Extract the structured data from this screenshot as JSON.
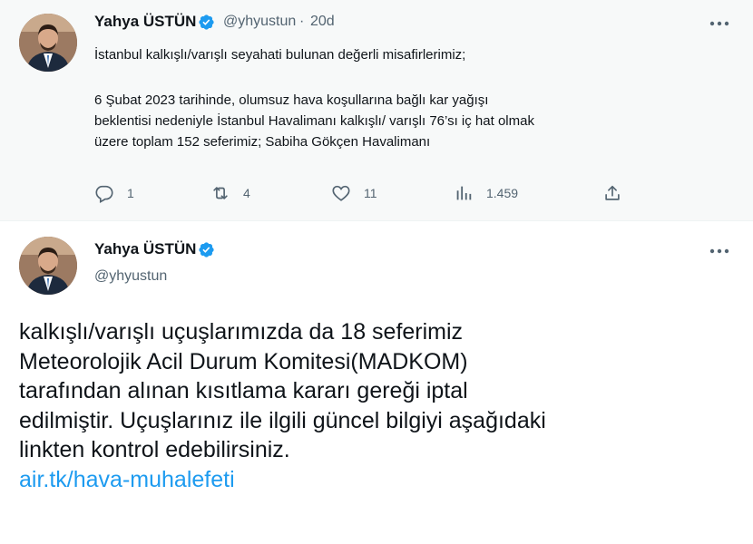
{
  "colors": {
    "accent": "#1d9bf0",
    "verified": "#1d9bf0",
    "muted": "#536471",
    "text": "#0f1419",
    "top_bg": "#f7f9f9"
  },
  "tweet1": {
    "author": "Yahya ÜSTÜN",
    "handle": "@yhyustun",
    "separator": "·",
    "time": "20d",
    "lines": [
      "İstanbul kalkışlı/varışlı seyahati bulunan değerli misafirlerimiz;",
      "6 Şubat 2023 tarihinde, olumsuz hava koşullarına bağlı kar yağışı",
      "beklentisi nedeniyle İstanbul Havalimanı kalkışlı/ varışlı 76’sı iç hat olmak",
      "üzere toplam 152 seferimiz; Sabiha Gökçen Havalimanı"
    ],
    "actions": {
      "reply": {
        "icon": "reply-icon",
        "count": "1"
      },
      "retweet": {
        "icon": "retweet-icon",
        "count": "4"
      },
      "like": {
        "icon": "heart-icon",
        "count": "11"
      },
      "views": {
        "icon": "views-icon",
        "count": "1.459"
      },
      "share": {
        "icon": "share-icon"
      }
    }
  },
  "tweet2": {
    "author": "Yahya ÜSTÜN",
    "handle": "@yhyustun",
    "lines": [
      "kalkışlı/varışlı uçuşlarımızda da 18 seferimiz",
      "Meteorolojik Acil Durum Komitesi(MADKOM)",
      "tarafından alınan kısıtlama kararı gereği iptal",
      "edilmiştir. Uçuşlarınız ile ilgili güncel bilgiyi  aşağıdaki",
      "linkten kontrol edebilirsiniz."
    ],
    "link": "air.tk/hava-muhalefeti"
  }
}
